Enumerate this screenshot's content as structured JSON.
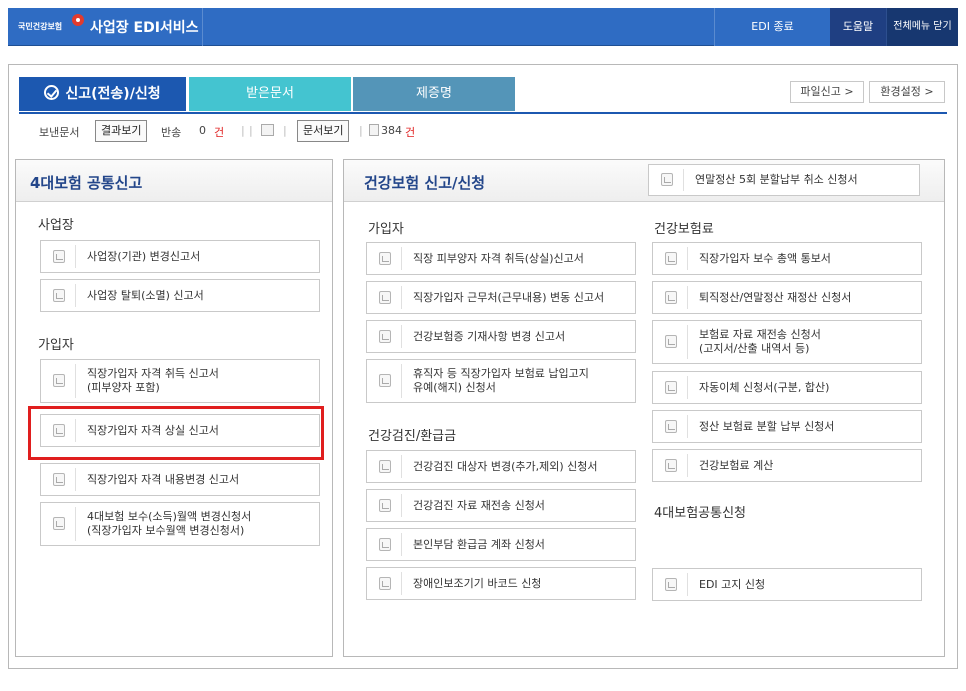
{
  "header": {
    "logo_text": "국민건강보험",
    "service_title": "사업장 EDI서비스",
    "edi_end": "EDI 종료",
    "help": "도움말",
    "all_menu": "전체메뉴 닫기"
  },
  "tabs": {
    "report": "신고(전송)/신청",
    "received": "받은문서",
    "certificate": "제증명"
  },
  "toolbar": {
    "file_report": "파일신고 >",
    "settings": "환경설정 >"
  },
  "status": {
    "sent_label": "보낸문서",
    "result_view": "결과보기",
    "return_label": "반송",
    "return_count": "0",
    "unit": "건",
    "doc_view": "문서보기",
    "doc_count": "384",
    "doc_unit": "건"
  },
  "left_panel": {
    "title": "4대보험 공통신고",
    "sections": {
      "workplace": "사업장",
      "subscriber": "가입자"
    },
    "items": [
      "사업장(기관) 변경신고서",
      "사업장 탈퇴(소멸) 신고서",
      "직장가입자 자격 취득 신고서\n(피부양자 포함)",
      "직장가입자 자격 상실 신고서",
      "직장가입자 자격 내용변경 신고서",
      "4대보험 보수(소득)월액 변경신청서\n(직장가입자 보수월액 변경신청서)"
    ]
  },
  "right_panel": {
    "title": "건강보험 신고/신청",
    "top_item": "연말정산 5회 분할납부 취소 신청서",
    "sections": {
      "subscriber": "가입자",
      "checkup": "건강검진/환급금",
      "premium": "건강보험료",
      "common": "4대보험공통신청"
    },
    "subscriber_items": [
      "직장 피부양자 자격 취득(상실)신고서",
      "직장가입자 근무처(근무내용) 변동 신고서",
      "건강보험증 기재사항 변경 신고서",
      "휴직자 등 직장가입자 보험료 납입고지\n유예(해지) 신청서"
    ],
    "checkup_items": [
      "건강검진 대상자 변경(추가,제외) 신청서",
      "건강검진 자료 재전송 신청서",
      "본인부담 환급금 계좌 신청서",
      "장애인보조기기 바코드 신청"
    ],
    "premium_items": [
      "직장가입자 보수 총액 통보서",
      "퇴직정산/연말정산 재정산 신청서",
      "보험료 자료 재전송 신청서\n(고지서/산출 내역서 등)",
      "자동이체 신청서(구분, 합산)",
      "정산 보험료 분할 납부 신청서",
      "건강보험료 계산"
    ],
    "common_items": [
      "EDI 고지 신청"
    ]
  }
}
